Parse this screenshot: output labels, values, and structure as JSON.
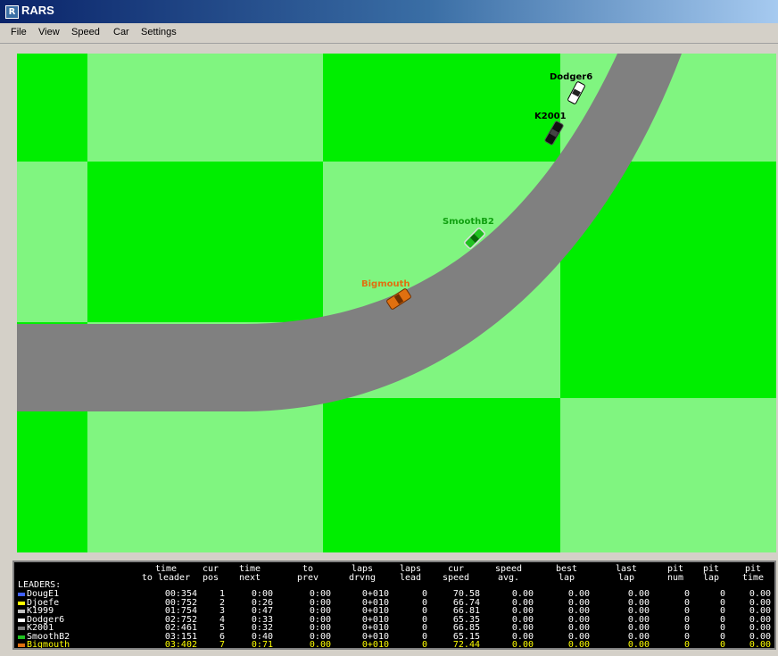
{
  "window": {
    "title": "RARS",
    "icon_letter": "R"
  },
  "menu": [
    {
      "id": "file",
      "label": "File"
    },
    {
      "id": "view",
      "label": "View"
    },
    {
      "id": "speed",
      "label": "Speed"
    },
    {
      "id": "car",
      "label": "Car"
    },
    {
      "id": "settings",
      "label": "Settings"
    }
  ],
  "colors": {
    "grass_dark": "#00ee00",
    "grass_light": "#80f580",
    "track": "#808080",
    "leader_bg": "#000000",
    "text": "#ffffff",
    "highlight": "#ffff00"
  },
  "cars": [
    {
      "id": "dodger6",
      "name": "Dodger6",
      "color": "#ffffff",
      "label_color": "#000000"
    },
    {
      "id": "k2001",
      "name": "K2001",
      "color": "#101010",
      "label_color": "#000000"
    },
    {
      "id": "smoothb2",
      "name": "SmoothB2",
      "color": "#20c020",
      "label_color": "#10a010"
    },
    {
      "id": "bigmouth",
      "name": "Bigmouth",
      "color": "#e07010",
      "label_color": "#e07010"
    }
  ],
  "leaders": {
    "title": "LEADERS:",
    "columns": [
      {
        "id": "time_to_leader",
        "l1": "time",
        "l2": "to leader"
      },
      {
        "id": "cur_pos",
        "l1": "cur",
        "l2": "pos"
      },
      {
        "id": "time_to_next",
        "l1": "time",
        "l2": "next"
      },
      {
        "id": "time_to_prev",
        "l1": "to",
        "l2": "prev"
      },
      {
        "id": "laps_driven",
        "l1": "laps",
        "l2": "drvng"
      },
      {
        "id": "laps_lead",
        "l1": "laps",
        "l2": "lead"
      },
      {
        "id": "cur_speed",
        "l1": "cur",
        "l2": "speed"
      },
      {
        "id": "speed_avg",
        "l1": "speed",
        "l2": "avg."
      },
      {
        "id": "best_lap",
        "l1": "best",
        "l2": "lap"
      },
      {
        "id": "last_lap",
        "l1": "last",
        "l2": "lap"
      },
      {
        "id": "pit_num",
        "l1": "pit",
        "l2": "num"
      },
      {
        "id": "pit_lap",
        "l1": "pit",
        "l2": "lap"
      },
      {
        "id": "pit_time",
        "l1": "pit",
        "l2": "time"
      }
    ],
    "rows": [
      {
        "name": "DougE1",
        "color": "#4060ff",
        "values": [
          "00:354",
          "1",
          "0:00",
          "0:00",
          "0+010",
          "0",
          "70.58",
          "0.00",
          "0.00",
          "0.00",
          "0",
          "0",
          "0.00"
        ]
      },
      {
        "name": "Djoefe",
        "color": "#ffff00",
        "values": [
          "00:752",
          "2",
          "0:26",
          "0:00",
          "0+010",
          "0",
          "66.74",
          "0.00",
          "0.00",
          "0.00",
          "0",
          "0",
          "0.00"
        ]
      },
      {
        "name": "K1999",
        "color": "#c0c0c0",
        "values": [
          "01:754",
          "3",
          "0:47",
          "0:00",
          "0+010",
          "0",
          "66.81",
          "0.00",
          "0.00",
          "0.00",
          "0",
          "0",
          "0.00"
        ]
      },
      {
        "name": "Dodger6",
        "color": "#ffffff",
        "values": [
          "02:752",
          "4",
          "0:33",
          "0:00",
          "0+010",
          "0",
          "65.35",
          "0.00",
          "0.00",
          "0.00",
          "0",
          "0",
          "0.00"
        ]
      },
      {
        "name": "K2001",
        "color": "#808080",
        "values": [
          "02:461",
          "5",
          "0:32",
          "0:00",
          "0+010",
          "0",
          "66.85",
          "0.00",
          "0.00",
          "0.00",
          "0",
          "0",
          "0.00"
        ]
      },
      {
        "name": "SmoothB2",
        "color": "#20c020",
        "values": [
          "03:151",
          "6",
          "0:40",
          "0:00",
          "0+010",
          "0",
          "65.15",
          "0.00",
          "0.00",
          "0.00",
          "0",
          "0",
          "0.00"
        ]
      },
      {
        "name": "Bigmouth",
        "color": "#e07010",
        "highlight": true,
        "values": [
          "03:402",
          "7",
          "0:71",
          "0.00",
          "0+010",
          "0",
          "72.44",
          "0.00",
          "0.00",
          "0.00",
          "0",
          "0",
          "0.00"
        ]
      }
    ]
  }
}
